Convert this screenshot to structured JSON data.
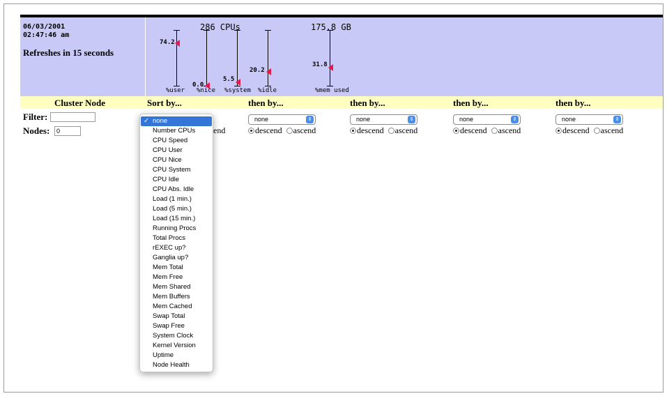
{
  "status": {
    "date": "06/03/2001",
    "time": "02:47:46 am",
    "refresh": "Refreshes in 15 seconds"
  },
  "gauges": {
    "cpus_title": "286 CPUs",
    "mem_title": "175.8 GB",
    "items": [
      {
        "label": "%user",
        "value": "74.2",
        "level": 74.2
      },
      {
        "label": "%nice",
        "value": "0.0",
        "level": 0.0
      },
      {
        "label": "%system",
        "value": "5.5",
        "level": 5.5
      },
      {
        "label": "%idle",
        "value": "20.2",
        "level": 20.2
      },
      {
        "label": "%mem used",
        "value": "31.8",
        "level": 31.8
      }
    ]
  },
  "headers": {
    "cluster_node": "Cluster Node",
    "sort_by": "Sort by...",
    "then_by": "then by..."
  },
  "filter": {
    "filter_label": "Filter:",
    "filter_value": "",
    "nodes_label": "Nodes:",
    "nodes_value": "0"
  },
  "selects": [
    {
      "value": "none"
    },
    {
      "value": "none"
    },
    {
      "value": "none"
    },
    {
      "value": "none"
    },
    {
      "value": "none"
    }
  ],
  "order": {
    "descend": "descend",
    "ascend": "ascend",
    "partial_hidden": "end"
  },
  "dropdown": {
    "check": "✓",
    "options": [
      "none",
      "Number CPUs",
      "CPU Speed",
      "CPU User",
      "CPU Nice",
      "CPU System",
      "CPU Idle",
      "CPU Abs. Idle",
      "Load (1 min.)",
      "Load (5 min.)",
      "Load (15 min.)",
      "Running Procs",
      "Total Procs",
      "rEXEC up?",
      "Ganglia up?",
      "Mem Total",
      "Mem Free",
      "Mem Shared",
      "Mem Buffers",
      "Mem Cached",
      "Swap Total",
      "Swap Free",
      "System Clock",
      "Kernel Version",
      "Uptime",
      "Node Health"
    ],
    "selected_index": 0
  },
  "colors": {
    "panel": "#c9c9f7",
    "header_row": "#ffffc2",
    "marker": "#e8174e",
    "menu_highlight": "#3476d8"
  }
}
